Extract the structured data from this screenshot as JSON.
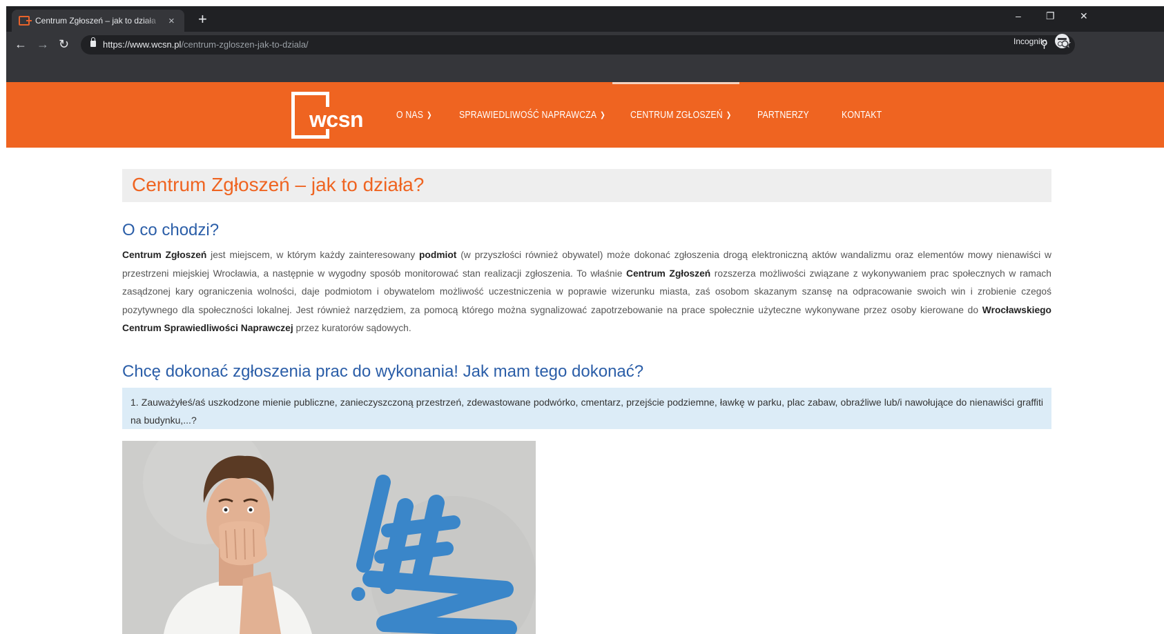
{
  "browser": {
    "tab_title": "Centrum Zgłoszeń – jak to działa",
    "tab_close": "×",
    "new_tab": "+",
    "url_host": "https://www.wcsn.pl",
    "url_path": "/centrum-zgloszen-jak-to-dziala/",
    "incognito_label": "Incognito",
    "icons": [
      "back-icon",
      "forward-icon",
      "reload-icon",
      "lock-icon",
      "zoom-icon",
      "star-icon",
      "incognito-icon",
      "menu-icon",
      "minimize-icon",
      "restore-icon",
      "close-icon"
    ]
  },
  "site": {
    "logo_text": "wcsn",
    "brand_color": "#ef6421",
    "nav": [
      {
        "label": "O NAS",
        "has_dropdown": true
      },
      {
        "label": "SPRAWIEDLIWOŚĆ NAPRAWCZA",
        "has_dropdown": true
      },
      {
        "label": "CENTRUM ZGŁOSZEŃ",
        "has_dropdown": true,
        "active": true
      },
      {
        "label": "PARTNERZY",
        "has_dropdown": false
      },
      {
        "label": "KONTAKT",
        "has_dropdown": false
      }
    ]
  },
  "content": {
    "page_title": "Centrum Zgłoszeń – jak to działa?",
    "section1_heading": "O co chodzi?",
    "para": {
      "t1": "Centrum Zgłoszeń",
      "t2": " jest miejscem, w którym każdy zainteresowany ",
      "t3": "podmiot",
      "t4": " (w przyszłości również obywatel) może dokonać zgłoszenia drogą elektroniczną aktów wandalizmu oraz elementów mowy nienawiści w przestrzeni miejskiej Wrocławia, a następnie w wygodny sposób monitorować stan realizacji zgłoszenia. To właśnie ",
      "t5": "Centrum Zgłoszeń",
      "t6": " rozszerza możliwości związane z wykonywaniem prac społecznych w ramach zasądzonej kary ograniczenia wolności, daje podmiotom i obywatelom możliwość uczestniczenia w poprawie wizerunku miasta, zaś osobom skazanym szansę na odpracowanie swoich win i zrobienie czegoś pozytywnego dla społeczności lokalnej. Jest również narzędziem, za pomocą którego można sygnalizować zapotrzebowanie na prace społecznie użyteczne wykonywane przez osoby kierowane do ",
      "t7": "Wrocławskiego Centrum Sprawiedliwości Naprawczej",
      "t8": " przez kuratorów sądowych."
    },
    "section2_heading": "Chcę dokonać zgłoszenia prac do wykonania! Jak mam tego dokonać?",
    "step1": "1. Zauważyłeś/aś uszkodzone mienie publiczne, zanieczyszczoną przestrzeń, zdewastowane podwórko, cmentarz, przejście podziemne, ławkę w parku, plac zabaw, obraźliwe lub/i nawołujące do nienawiści graffiti na budynku,...?"
  }
}
